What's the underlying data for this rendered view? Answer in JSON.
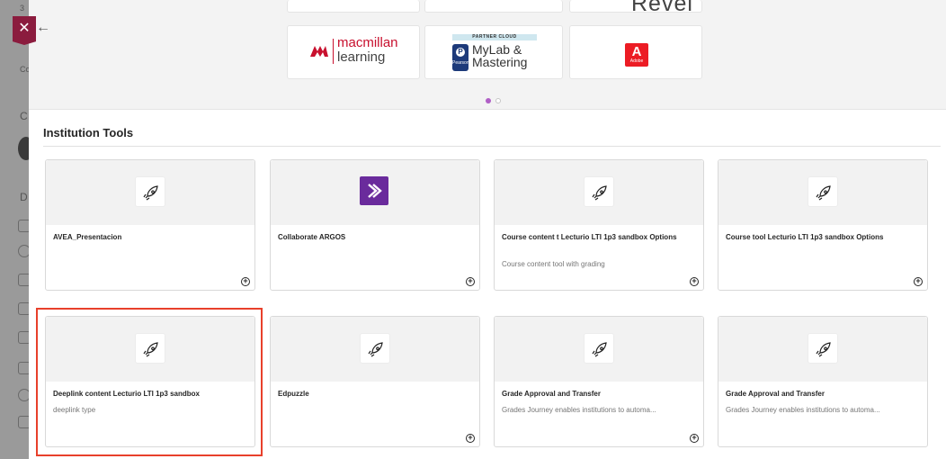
{
  "close_icon": "close-icon",
  "collapse_icon": "arrow-left-icon",
  "background_app": {
    "tab_label": "Co",
    "labels": [
      "C",
      "D"
    ],
    "number": "3"
  },
  "carousel": {
    "partial_logo": "Revel",
    "logos": [
      {
        "name": "macmillan learning",
        "line1": "macmillan",
        "line2": "learning"
      },
      {
        "name": "MyLab & Mastering",
        "banner": "PARTNER CLOUD",
        "publisher": "Pearson",
        "line1": "MyLab &",
        "line2": "Mastering"
      },
      {
        "name": "Adobe",
        "mark": "A",
        "caption": "Adobe"
      }
    ],
    "page_count": 2,
    "active_page": 1
  },
  "section": {
    "title": "Institution Tools"
  },
  "tools": [
    {
      "name": "AVEA_Presentacion",
      "description": "",
      "icon": "rocket-icon"
    },
    {
      "name": "Collaborate ARGOS",
      "description": "",
      "icon": "argos-icon"
    },
    {
      "name": "Course content t Lecturio LTI 1p3 sandbox Options",
      "description": "Course content tool with grading",
      "icon": "rocket-icon"
    },
    {
      "name": "Course tool Lecturio LTI 1p3 sandbox Options",
      "description": "",
      "icon": "rocket-icon"
    },
    {
      "name": "Deeplink content Lecturio LTI 1p3 sandbox",
      "description": "deeplink type",
      "icon": "rocket-icon"
    },
    {
      "name": "Edpuzzle",
      "description": "",
      "icon": "rocket-icon"
    },
    {
      "name": "Grade Approval and Transfer",
      "description": "Grades Journey enables institutions to automa...",
      "icon": "rocket-icon"
    },
    {
      "name": "Grade Approval and Transfer",
      "description": "Grades Journey enables institutions to automa...",
      "icon": "rocket-icon"
    }
  ],
  "add_icon": "plus-circle-icon",
  "colors": {
    "accent": "#8b1c3e",
    "highlight": "#e8402b",
    "carousel_dot": "#b05fc6",
    "argos": "#6a2b9c",
    "adobe": "#ec1c24",
    "macmillan": "#c8102e"
  }
}
